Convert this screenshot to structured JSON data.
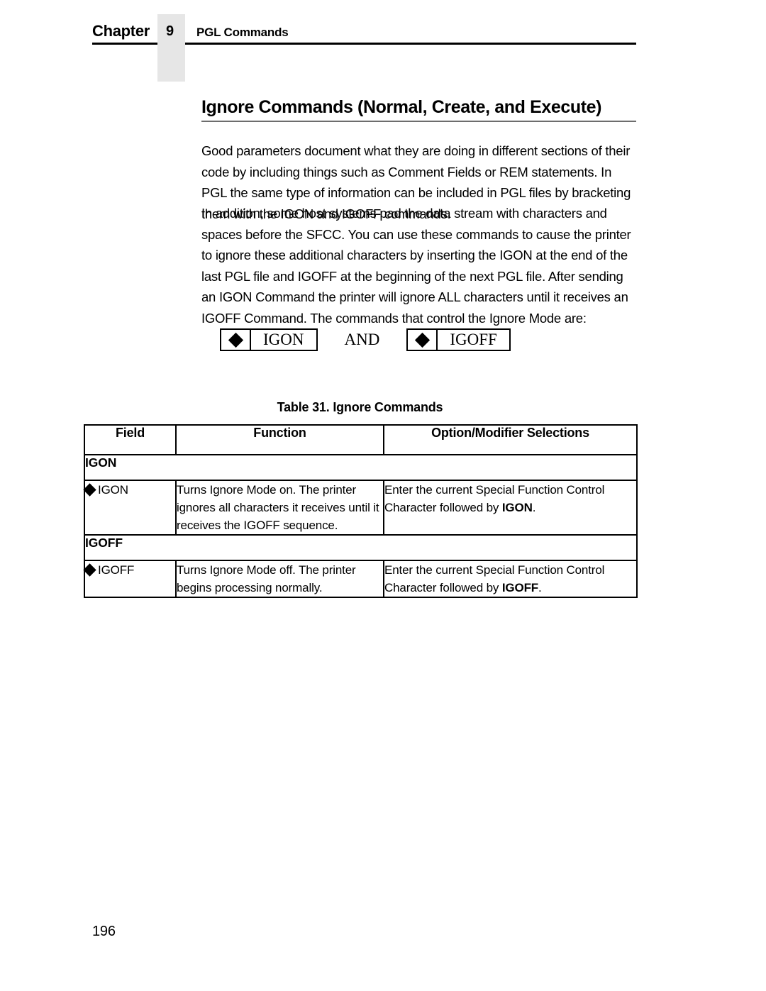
{
  "header": {
    "chapter_label": "Chapter",
    "chapter_number": "9",
    "chapter_subject": "PGL Commands"
  },
  "section": {
    "title": "Ignore Commands (Normal, Create, and Execute)"
  },
  "paragraphs": [
    "Good parameters document what they are doing in different sections of their code by including things such as Comment Fields or REM statements. In PGL the same type of information can be included in PGL files by bracketing them with the IGON and IGOFF commands.",
    "In addition, some host systems pad the data stream with characters and spaces before the SFCC. You can use these commands to cause the printer to ignore these additional characters by inserting the IGON at the end of the last PGL file and IGOFF at the beginning of the next PGL file. After sending an IGON Command the printer will ignore ALL characters until it receives an IGOFF Command. The commands that control the Ignore Mode are:"
  ],
  "syntax_diagram": {
    "first_box_label": "IGON",
    "conjunction": "AND",
    "second_box_label": "IGOFF",
    "diamond_icon": "sfcc-diamond-icon"
  },
  "table": {
    "caption": "Table 31. Ignore Commands",
    "columns": [
      "Field",
      "Function",
      "Option/Modifier Selections"
    ],
    "groups": [
      {
        "group_label": "IGON",
        "rows": [
          {
            "field": "IGON",
            "function": "Turns Ignore Mode on. The printer ignores all characters it receives until it receives the IGOFF sequence.",
            "option_prefix": "Enter the current Special Function Control Character followed by ",
            "option_bold": "IGON",
            "option_suffix": "."
          }
        ]
      },
      {
        "group_label": "IGOFF",
        "rows": [
          {
            "field": "IGOFF",
            "function": "Turns Ignore Mode off. The printer begins processing normally.",
            "option_prefix": "Enter the current Special Function Control Character followed by ",
            "option_bold": "IGOFF",
            "option_suffix": "."
          }
        ]
      }
    ]
  },
  "footer": {
    "page_number": "196"
  },
  "colors": {
    "text": "#000000",
    "page_background": "#ffffff",
    "chapter_band": "#e6e6e6",
    "title_rule": "#6d6d6d",
    "table_border": "#000000"
  }
}
